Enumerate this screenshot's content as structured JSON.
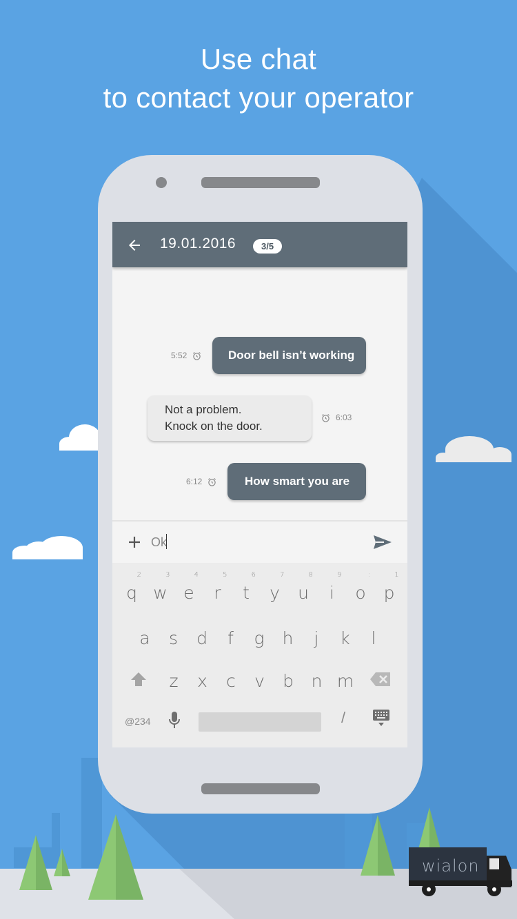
{
  "headline": {
    "line1": "Use chat",
    "line2": "to contact your operator"
  },
  "colors": {
    "background": "#5aa3e3",
    "app_bar": "#5f6d78",
    "outgoing_bubble": "#5f6d78",
    "incoming_bubble": "#ebebeb",
    "tree_light": "#8dc874",
    "tree_dark": "#7ab465",
    "truck": "#2c3440"
  },
  "app_bar": {
    "back_icon": "arrow-left-icon",
    "title": "19.01.2016",
    "counter": "3/5"
  },
  "messages": [
    {
      "direction": "outgoing",
      "text": "Door bell isn’t working",
      "time": "5:52",
      "icon": "alarm-clock-icon"
    },
    {
      "direction": "incoming",
      "line1": "Not a problem.",
      "line2": "Knock on the door.",
      "time": "6:03",
      "icon": "alarm-clock-icon"
    },
    {
      "direction": "outgoing",
      "text": "How smart you are",
      "time": "6:12",
      "icon": "alarm-clock-icon"
    }
  ],
  "composer": {
    "attach_icon": "plus-icon",
    "value": "Ok",
    "send_icon": "send-icon"
  },
  "keyboard": {
    "row1": [
      {
        "ch": "q",
        "hint": "2"
      },
      {
        "ch": "w",
        "hint": "3"
      },
      {
        "ch": "e",
        "hint": "4"
      },
      {
        "ch": "r",
        "hint": "5"
      },
      {
        "ch": "t",
        "hint": "6"
      },
      {
        "ch": "y",
        "hint": "7"
      },
      {
        "ch": "u",
        "hint": "8"
      },
      {
        "ch": "i",
        "hint": "9"
      },
      {
        "ch": "o",
        "hint": ":"
      },
      {
        "ch": "p",
        "hint": "1"
      }
    ],
    "row2": [
      "a",
      "s",
      "d",
      "f",
      "g",
      "h",
      "j",
      "k",
      "l"
    ],
    "row3": [
      "z",
      "x",
      "c",
      "v",
      "b",
      "n",
      "m"
    ],
    "symbols_key": "@234",
    "slash_key": "/",
    "shift_icon": "shift-arrow-icon",
    "backspace_icon": "backspace-icon",
    "mic_icon": "microphone-icon",
    "hide_keyboard_icon": "keyboard-hide-icon"
  },
  "brand": {
    "truck_label": "wialon"
  }
}
